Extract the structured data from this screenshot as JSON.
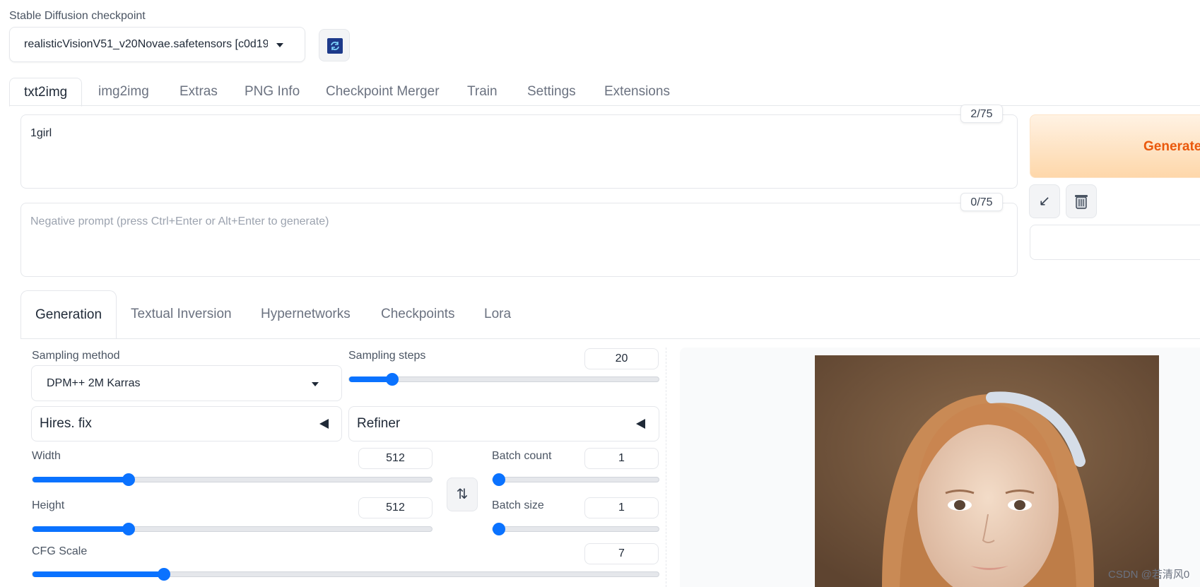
{
  "checkpoint": {
    "label": "Stable Diffusion checkpoint",
    "value": "realisticVisionV51_v20Novae.safetensors [c0d19",
    "refresh_icon": "refresh-icon"
  },
  "tabs": [
    "txt2img",
    "img2img",
    "Extras",
    "PNG Info",
    "Checkpoint Merger",
    "Train",
    "Settings",
    "Extensions"
  ],
  "prompt": {
    "text": "1girl",
    "token_count": "2/75"
  },
  "negative_prompt": {
    "placeholder": "Negative prompt (press Ctrl+Enter or Alt+Enter to generate)",
    "token_count": "0/75"
  },
  "actions": {
    "generate_label": "Generate",
    "read_params_icon": "arrow-down-left-icon",
    "clear_icon": "trash-icon"
  },
  "subtabs": [
    "Generation",
    "Textual Inversion",
    "Hypernetworks",
    "Checkpoints",
    "Lora"
  ],
  "generation": {
    "sampling_method_label": "Sampling method",
    "sampling_method_value": "DPM++ 2M Karras",
    "sampling_steps_label": "Sampling steps",
    "sampling_steps_value": "20",
    "sampling_steps_fraction": 0.14,
    "hires_label": "Hires. fix",
    "refiner_label": "Refiner",
    "width_label": "Width",
    "width_value": "512",
    "width_fraction": 0.24,
    "height_label": "Height",
    "height_value": "512",
    "height_fraction": 0.24,
    "batch_count_label": "Batch count",
    "batch_count_value": "1",
    "batch_count_fraction": 0.0,
    "batch_size_label": "Batch size",
    "batch_size_value": "1",
    "batch_size_fraction": 0.0,
    "cfg_label": "CFG Scale",
    "cfg_value": "7",
    "cfg_fraction": 0.21,
    "swap_icon": "swap-vertical-icon"
  },
  "watermark": "CSDN @若清风0",
  "colors": {
    "accent": "#0a72ff",
    "generate_text": "#ea580c",
    "generate_bg": "#fed7aa"
  }
}
